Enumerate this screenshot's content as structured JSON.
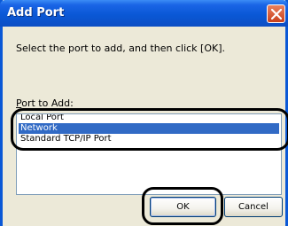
{
  "window": {
    "title": "Add Port",
    "close_icon": "close-icon"
  },
  "dialog": {
    "instruction": "Select the port to add, and then click [OK].",
    "port_label": "Port to Add:"
  },
  "port_list": {
    "items": [
      {
        "label": "Local Port",
        "selected": false
      },
      {
        "label": "Network",
        "selected": true
      },
      {
        "label": "Standard TCP/IP Port",
        "selected": false
      }
    ]
  },
  "buttons": {
    "ok_label": "OK",
    "cancel_label": "Cancel"
  },
  "colors": {
    "titlebar": "#0a58d6",
    "selection": "#316ac5",
    "callout": "#000000"
  }
}
